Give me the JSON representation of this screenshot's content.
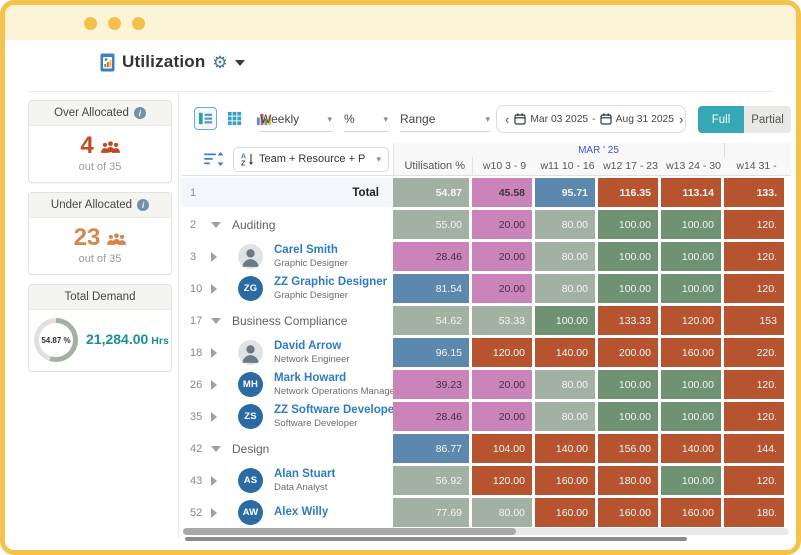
{
  "window": {
    "title": "Utilization"
  },
  "icons": {
    "info": "i",
    "gear": "⚙",
    "chevron_left": "‹",
    "chevron_right": "›",
    "select_caret": "▾",
    "pill_caret": "▾"
  },
  "summary_cards": {
    "over_allocated": {
      "title": "Over Allocated",
      "value": "4",
      "caption": "out of 35"
    },
    "under_allocated": {
      "title": "Under Allocated",
      "value": "23",
      "caption": "out of 35"
    },
    "total_demand": {
      "title": "Total Demand",
      "percent": "54.87 %",
      "hours": "21,284.00",
      "unit": "Hrs"
    }
  },
  "toolbar": {
    "period_select": "Weekly",
    "unit_select": "%",
    "range_select": "Range",
    "date_from": "Mar 03 2025",
    "date_separator": "-",
    "date_to": "Aug 31 2025",
    "full_button": "Full",
    "partial_button": "Partial"
  },
  "table": {
    "sort_dropdown_label": "Team + Resource + Proj...",
    "utilisation_column_header": "Utilisation %",
    "month_group_header": "MAR ' 25",
    "week_headers": [
      "w10 3 - 9",
      "w11 10 - 16",
      "w12 17 - 23",
      "w13 24 - 30",
      "w14 31 -"
    ],
    "rows": [
      {
        "num": "1",
        "type": "total",
        "label": "Total",
        "util": {
          "v": "54.87",
          "c": "sage"
        },
        "weeks": [
          {
            "v": "45.58",
            "c": "pink"
          },
          {
            "v": "95.71",
            "c": "blue"
          },
          {
            "v": "116.35",
            "c": "red"
          },
          {
            "v": "113.14",
            "c": "red"
          },
          {
            "v": "133.",
            "c": "red"
          }
        ]
      },
      {
        "num": "2",
        "type": "group",
        "expanded": true,
        "label": "Auditing",
        "util": {
          "v": "55.00",
          "c": "sage"
        },
        "weeks": [
          {
            "v": "20.00",
            "c": "pink"
          },
          {
            "v": "80.00",
            "c": "sage"
          },
          {
            "v": "100.00",
            "c": "green"
          },
          {
            "v": "100.00",
            "c": "green"
          },
          {
            "v": "120.",
            "c": "red"
          }
        ]
      },
      {
        "num": "3",
        "type": "resource",
        "expanded": false,
        "name": "Carel Smith",
        "role": "Graphic Designer",
        "avatar": {
          "kind": "photo",
          "text": ""
        },
        "util": {
          "v": "28.46",
          "c": "pink"
        },
        "weeks": [
          {
            "v": "20.00",
            "c": "pink"
          },
          {
            "v": "80.00",
            "c": "sage"
          },
          {
            "v": "100.00",
            "c": "green"
          },
          {
            "v": "100.00",
            "c": "green"
          },
          {
            "v": "120.",
            "c": "red"
          }
        ]
      },
      {
        "num": "10",
        "type": "resource",
        "expanded": false,
        "name": "ZZ Graphic Designer",
        "role": "Graphic Designer",
        "avatar": {
          "kind": "initials",
          "text": "ZG"
        },
        "util": {
          "v": "81.54",
          "c": "blue"
        },
        "weeks": [
          {
            "v": "20.00",
            "c": "pink"
          },
          {
            "v": "80.00",
            "c": "sage"
          },
          {
            "v": "100.00",
            "c": "green"
          },
          {
            "v": "100.00",
            "c": "green"
          },
          {
            "v": "120.",
            "c": "red"
          }
        ]
      },
      {
        "num": "17",
        "type": "group",
        "expanded": true,
        "label": "Business Compliance",
        "util": {
          "v": "54.62",
          "c": "sage"
        },
        "weeks": [
          {
            "v": "53.33",
            "c": "sage"
          },
          {
            "v": "100.00",
            "c": "green"
          },
          {
            "v": "133.33",
            "c": "red"
          },
          {
            "v": "120.00",
            "c": "red"
          },
          {
            "v": "153",
            "c": "red"
          }
        ]
      },
      {
        "num": "18",
        "type": "resource",
        "expanded": false,
        "name": "David Arrow",
        "role": "Network Engineer",
        "avatar": {
          "kind": "photo",
          "text": ""
        },
        "util": {
          "v": "96.15",
          "c": "blue"
        },
        "weeks": [
          {
            "v": "120.00",
            "c": "red"
          },
          {
            "v": "140.00",
            "c": "red"
          },
          {
            "v": "200.00",
            "c": "red"
          },
          {
            "v": "160.00",
            "c": "red"
          },
          {
            "v": "220.",
            "c": "red"
          }
        ]
      },
      {
        "num": "26",
        "type": "resource",
        "expanded": false,
        "name": "Mark Howard",
        "role": "Network Operations Manager",
        "avatar": {
          "kind": "initials",
          "text": "MH"
        },
        "util": {
          "v": "39.23",
          "c": "pink"
        },
        "weeks": [
          {
            "v": "20.00",
            "c": "pink"
          },
          {
            "v": "80.00",
            "c": "sage"
          },
          {
            "v": "100.00",
            "c": "green"
          },
          {
            "v": "100.00",
            "c": "green"
          },
          {
            "v": "120.",
            "c": "red"
          }
        ]
      },
      {
        "num": "35",
        "type": "resource",
        "expanded": false,
        "name": "ZZ Software Developer",
        "role": "Software Developer",
        "avatar": {
          "kind": "initials",
          "text": "ZS"
        },
        "util": {
          "v": "28.46",
          "c": "pink"
        },
        "weeks": [
          {
            "v": "20.00",
            "c": "pink"
          },
          {
            "v": "80.00",
            "c": "sage"
          },
          {
            "v": "100.00",
            "c": "green"
          },
          {
            "v": "100.00",
            "c": "green"
          },
          {
            "v": "120.",
            "c": "red"
          }
        ]
      },
      {
        "num": "42",
        "type": "group",
        "expanded": true,
        "label": "Design",
        "util": {
          "v": "86.77",
          "c": "blue"
        },
        "weeks": [
          {
            "v": "104.00",
            "c": "red"
          },
          {
            "v": "140.00",
            "c": "red"
          },
          {
            "v": "156.00",
            "c": "red"
          },
          {
            "v": "140.00",
            "c": "red"
          },
          {
            "v": "144.",
            "c": "red"
          }
        ]
      },
      {
        "num": "43",
        "type": "resource",
        "expanded": false,
        "name": "Alan Stuart",
        "role": "Data Analyst",
        "avatar": {
          "kind": "initials",
          "text": "AS"
        },
        "util": {
          "v": "56.92",
          "c": "sage"
        },
        "weeks": [
          {
            "v": "120.00",
            "c": "red"
          },
          {
            "v": "160.00",
            "c": "red"
          },
          {
            "v": "180.00",
            "c": "red"
          },
          {
            "v": "100.00",
            "c": "green"
          },
          {
            "v": "120.",
            "c": "red"
          }
        ]
      },
      {
        "num": "52",
        "type": "resource",
        "expanded": false,
        "name": "Alex Willy",
        "role": "",
        "avatar": {
          "kind": "initials",
          "text": "AW"
        },
        "util": {
          "v": "77.69",
          "c": "sage"
        },
        "weeks": [
          {
            "v": "80.00",
            "c": "sage"
          },
          {
            "v": "160.00",
            "c": "red"
          },
          {
            "v": "160.00",
            "c": "red"
          },
          {
            "v": "160.00",
            "c": "red"
          },
          {
            "v": "180.",
            "c": "red"
          }
        ]
      }
    ]
  },
  "palette": {
    "pink": "#cb84ba",
    "sage": "#a3b1a2",
    "green": "#6f9273",
    "blue": "#5d88ae",
    "red": "#b5542e",
    "accent_teal": "#35a7b5",
    "over_red": "#c24a1e",
    "under_orange": "#d3874d",
    "link_blue": "#2e7cc3",
    "hrs_teal": "#1b8e96"
  }
}
